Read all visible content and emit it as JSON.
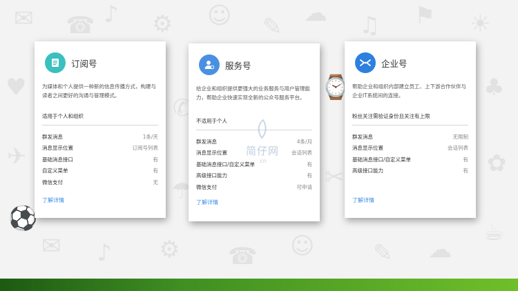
{
  "cards": [
    {
      "title": "订阅号",
      "description": "为媒体和个人提供一种新的信息传播方式，构建与读者之间更好的沟通与管理模式。",
      "audience": "适用于个人和组织",
      "rows": [
        {
          "key": "群发消息",
          "value": "1条/天"
        },
        {
          "key": "消息显示位置",
          "value": "订阅号列表"
        },
        {
          "key": "基础消息接口",
          "value": "有"
        },
        {
          "key": "自定义菜单",
          "value": "有"
        },
        {
          "key": "微信支付",
          "value": "无"
        }
      ],
      "more": "了解详情",
      "icon": "document-icon",
      "color": "#3bbfbf"
    },
    {
      "title": "服务号",
      "description": "给企业和组织提供更强大的业务服务与用户管理能力，帮助企业快速实现全新的公众号服务平台。",
      "audience": "不适用于个人",
      "rows": [
        {
          "key": "群发消息",
          "value": "4条/月"
        },
        {
          "key": "消息显示位置",
          "value": "会话列表"
        },
        {
          "key": "基础消息接口/自定义菜单",
          "value": "有"
        },
        {
          "key": "高级接口能力",
          "value": "有"
        },
        {
          "key": "微信支付",
          "value": "可申请"
        }
      ],
      "more": "了解详情",
      "icon": "user-service-icon",
      "color": "#4a90e2"
    },
    {
      "title": "企业号",
      "description": "帮助企业和组织内部建立员工、上下游合作伙伴与企业IT系统间的连接。",
      "audience": "粉丝关注需验证身份且关注有上限",
      "rows": [
        {
          "key": "群发消息",
          "value": "无限制"
        },
        {
          "key": "消息显示位置",
          "value": "会话列表"
        },
        {
          "key": "基础消息接口/自定义菜单",
          "value": "有"
        },
        {
          "key": "高级接口能力",
          "value": "有"
        }
      ],
      "more": "了解详情",
      "icon": "enterprise-icon",
      "color": "#2d7fe0"
    }
  ],
  "watermark": {
    "text": "简仔网",
    "sub": ".cn"
  }
}
